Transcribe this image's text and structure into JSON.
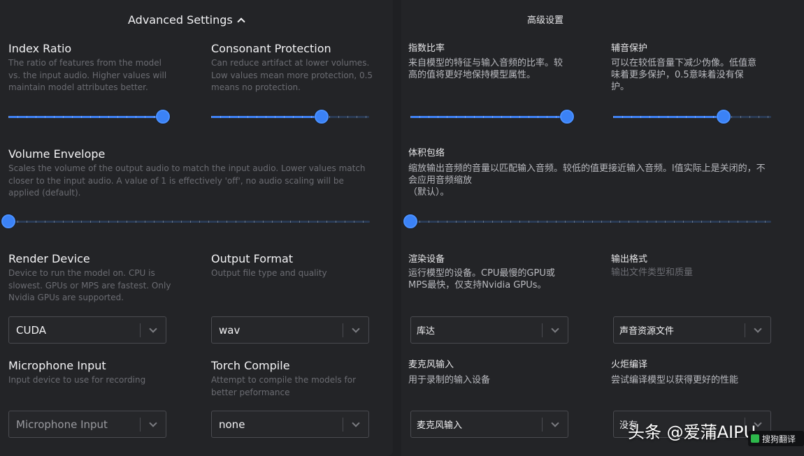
{
  "en": {
    "header": "Advanced Settings",
    "index_ratio": {
      "title": "Index Ratio",
      "desc": "The ratio of features from the model vs. the input audio. Higher values will maintain model attributes better.",
      "value": 0.98
    },
    "consonant_protection": {
      "title": "Consonant Protection",
      "desc": "Can reduce artifact at lower volumes. Low values mean more protection, 0.5 means no protection.",
      "value": 0.7
    },
    "volume_envelope": {
      "title": "Volume Envelope",
      "desc": "Scales the volume of the output audio to match the input audio. Lower values match closer to the input audio. A value of 1 is effectively 'off', no audio scaling will be applied (default).",
      "value": 0
    },
    "render_device": {
      "title": "Render Device",
      "desc": "Device to run the model on. CPU is slowest. GPUs or MPS are fastest. Only Nvidia GPUs are supported.",
      "value": "CUDA"
    },
    "output_format": {
      "title": "Output Format",
      "desc": "Output file type and quality",
      "value": "wav"
    },
    "microphone_input": {
      "title": "Microphone Input",
      "desc": "Input device to use for recording",
      "value": "Microphone Input"
    },
    "torch_compile": {
      "title": "Torch Compile",
      "desc": "Attempt to compile the models for better peformance",
      "value": "none"
    }
  },
  "zh": {
    "header": "高级设置",
    "index_ratio": {
      "title": "指数比率",
      "desc": "来自模型的特征与输入音频的比率。较高的值将更好地保持模型属性。",
      "value": 0.99
    },
    "consonant_protection": {
      "title": "辅音保护",
      "desc": "可以在较低音量下减少伪像。低值意味着更多保护，0.5意味着没有保护。",
      "value": 0.7
    },
    "volume_envelope": {
      "title": "体积包络",
      "desc": "缩放输出音频的音量以匹配输入音频。较低的值更接近输入音频。l值实际上是关闭的，不会应用音频缩放",
      "desc2": "（默认）。",
      "value": 0
    },
    "render_device": {
      "title": "渲染设备",
      "desc": "运行模型的设备。CPU最慢的GPU或MPS最快，仅支持Nvidia GPUs。",
      "value": "库达"
    },
    "output_format": {
      "title": "输出格式",
      "desc": "输出文件类型和质量",
      "value": "声音资源文件"
    },
    "microphone_input": {
      "title": "麦克风输入",
      "desc": "用于录制的输入设备",
      "value": "麦克风输入"
    },
    "torch_compile": {
      "title": "火炬编译",
      "desc": "尝试编译模型以获得更好的性能",
      "value": "没有"
    }
  },
  "watermark": "头条 @爱蒲AIPU",
  "badge": "搜狗翻译",
  "accent_color": "#3b82f6"
}
